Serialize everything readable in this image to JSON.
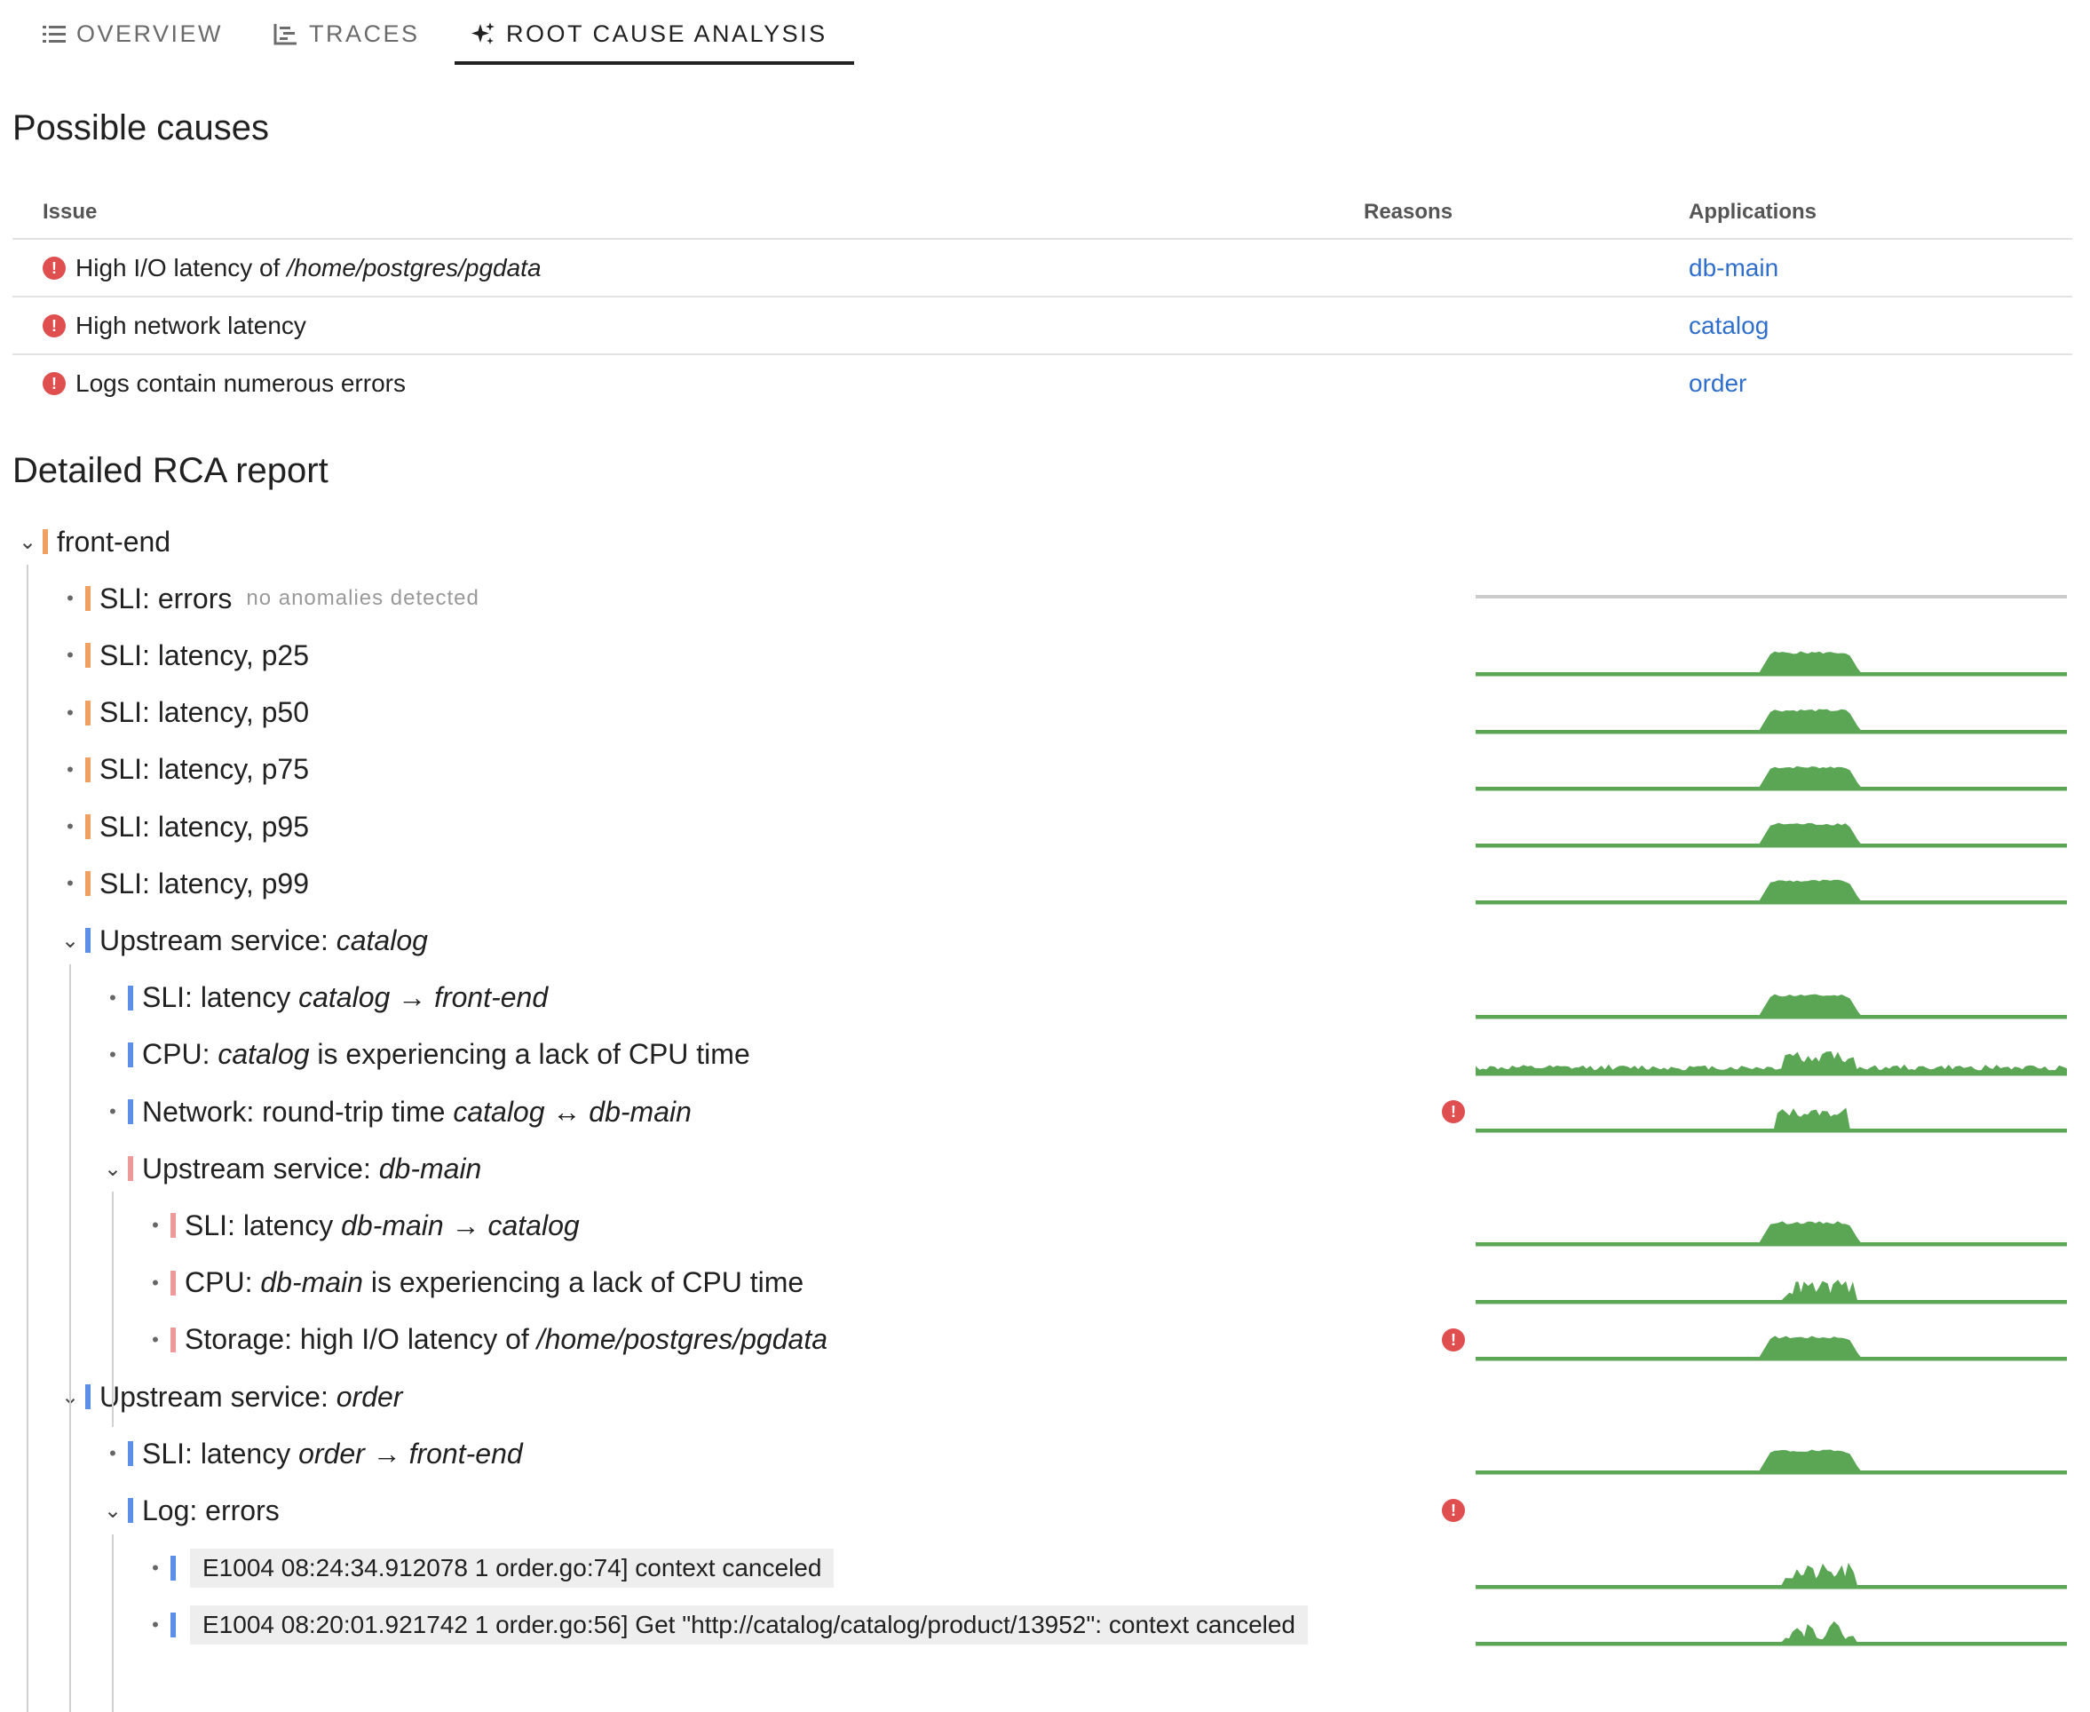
{
  "tabs": [
    {
      "label": "OVERVIEW",
      "icon": "list-icon"
    },
    {
      "label": "TRACES",
      "icon": "traces-icon"
    },
    {
      "label": "ROOT CAUSE ANALYSIS",
      "icon": "sparkle-icon"
    }
  ],
  "possible_causes": {
    "title": "Possible causes",
    "columns": [
      "Issue",
      "Reasons",
      "Applications"
    ],
    "rows": [
      {
        "issue_prefix": "High I/O latency of ",
        "issue_italic": "/home/postgres/pgdata",
        "reasons": "",
        "application": "db-main"
      },
      {
        "issue_prefix": "High network latency",
        "issue_italic": "",
        "reasons": "",
        "application": "catalog"
      },
      {
        "issue_prefix": "Logs contain numerous errors",
        "issue_italic": "",
        "reasons": "",
        "application": "order"
      }
    ]
  },
  "report": {
    "title": "Detailed RCA report",
    "nodes": [
      {
        "depth": 0,
        "kind": "chevron",
        "bar": "#f0a060",
        "parts": [
          [
            "front-end",
            false
          ]
        ],
        "spark": "none"
      },
      {
        "depth": 1,
        "kind": "dot",
        "bar": "#f0a060",
        "parts": [
          [
            "SLI: errors",
            false
          ]
        ],
        "note": "no anomalies detected",
        "spark": "flat"
      },
      {
        "depth": 1,
        "kind": "dot",
        "bar": "#f0a060",
        "parts": [
          [
            "SLI: latency, p25",
            false
          ]
        ],
        "spark": "plateau"
      },
      {
        "depth": 1,
        "kind": "dot",
        "bar": "#f0a060",
        "parts": [
          [
            "SLI: latency, p50",
            false
          ]
        ],
        "spark": "plateau"
      },
      {
        "depth": 1,
        "kind": "dot",
        "bar": "#f0a060",
        "parts": [
          [
            "SLI: latency, p75",
            false
          ]
        ],
        "spark": "plateau"
      },
      {
        "depth": 1,
        "kind": "dot",
        "bar": "#f0a060",
        "parts": [
          [
            "SLI: latency, p95",
            false
          ]
        ],
        "spark": "plateau"
      },
      {
        "depth": 1,
        "kind": "dot",
        "bar": "#f0a060",
        "parts": [
          [
            "SLI: latency, p99",
            false
          ]
        ],
        "spark": "plateau"
      },
      {
        "depth": 1,
        "kind": "chevron",
        "bar": "#5b8fe8",
        "parts": [
          [
            "Upstream service: ",
            false
          ],
          [
            "catalog",
            true
          ]
        ],
        "spark": "none"
      },
      {
        "depth": 2,
        "kind": "dot",
        "bar": "#5b8fe8",
        "parts": [
          [
            "SLI: latency ",
            false
          ],
          [
            "catalog",
            true
          ],
          [
            " → ",
            false
          ],
          [
            "front-end",
            true
          ]
        ],
        "spark": "plateau"
      },
      {
        "depth": 2,
        "kind": "dot",
        "bar": "#5b8fe8",
        "parts": [
          [
            "CPU: ",
            false
          ],
          [
            "catalog",
            true
          ],
          [
            " is experiencing a lack of CPU time",
            false
          ]
        ],
        "spark": "noisy"
      },
      {
        "depth": 2,
        "kind": "dot",
        "bar": "#5b8fe8",
        "parts": [
          [
            "Network: round-trip time ",
            false
          ],
          [
            "catalog",
            true
          ],
          [
            " ↔ ",
            false
          ],
          [
            "db-main",
            true
          ]
        ],
        "spark": "bumpy",
        "error": true
      },
      {
        "depth": 2,
        "kind": "chevron",
        "bar": "#ef9a9a",
        "parts": [
          [
            "Upstream service: ",
            false
          ],
          [
            "db-main",
            true
          ]
        ],
        "spark": "none"
      },
      {
        "depth": 3,
        "kind": "dot",
        "bar": "#ef9a9a",
        "parts": [
          [
            "SLI: latency ",
            false
          ],
          [
            "db-main",
            true
          ],
          [
            " → ",
            false
          ],
          [
            "catalog",
            true
          ]
        ],
        "spark": "plateau"
      },
      {
        "depth": 3,
        "kind": "dot",
        "bar": "#ef9a9a",
        "parts": [
          [
            "CPU: ",
            false
          ],
          [
            "db-main",
            true
          ],
          [
            " is experiencing a lack of CPU time",
            false
          ]
        ],
        "spark": "spiky"
      },
      {
        "depth": 3,
        "kind": "dot",
        "bar": "#ef9a9a",
        "parts": [
          [
            "Storage: high I/O latency of ",
            false
          ],
          [
            "/home/postgres/pgdata",
            true
          ]
        ],
        "spark": "plateau",
        "error": true
      },
      {
        "depth": 1,
        "kind": "chevron",
        "bar": "#5b8fe8",
        "parts": [
          [
            "Upstream service: ",
            false
          ],
          [
            "order",
            true
          ]
        ],
        "spark": "none"
      },
      {
        "depth": 2,
        "kind": "dot",
        "bar": "#5b8fe8",
        "parts": [
          [
            "SLI: latency ",
            false
          ],
          [
            "order",
            true
          ],
          [
            " → ",
            false
          ],
          [
            "front-end",
            true
          ]
        ],
        "spark": "plateau"
      },
      {
        "depth": 2,
        "kind": "chevron",
        "bar": "#5b8fe8",
        "parts": [
          [
            "Log: errors",
            false
          ]
        ],
        "spark": "none",
        "error": true
      },
      {
        "depth": 3,
        "kind": "dot",
        "bar": "#5b8fe8",
        "log": "E1004 08:24:34.912078 1 order.go:74] context canceled",
        "spark": "spiky"
      },
      {
        "depth": 3,
        "kind": "dot",
        "bar": "#5b8fe8",
        "log": "E1004 08:20:01.921742 1 order.go:56] Get \"http://catalog/catalog/product/13952\": context canceled",
        "spark": "spiky"
      }
    ]
  },
  "colors": {
    "sparkline": "#5aa655",
    "flat_line": "#cccccc",
    "error": "#e04f4f",
    "link": "#2f6fcb"
  }
}
